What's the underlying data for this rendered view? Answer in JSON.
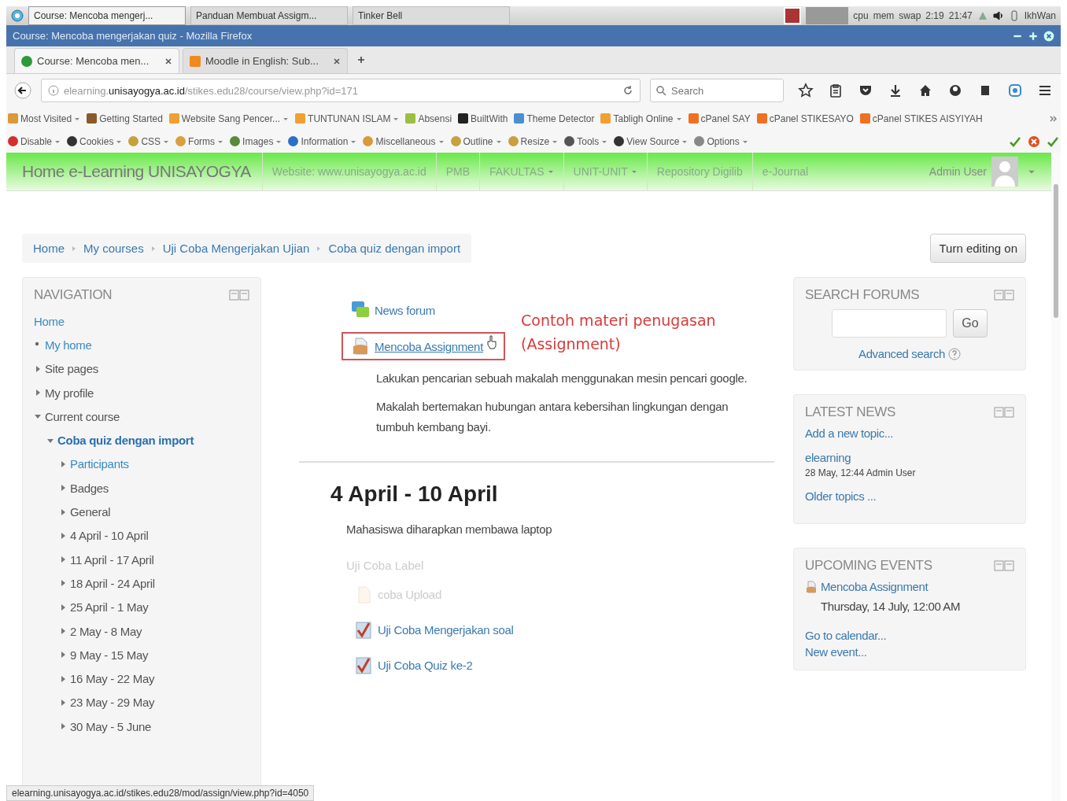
{
  "taskbar": {
    "tasks": [
      {
        "label": "Course: Mencoba mengerj...",
        "selected": true
      },
      {
        "label": "Panduan Membuat Assigm...",
        "selected": false
      },
      {
        "label": "Tinker Bell",
        "selected": false
      }
    ],
    "tray": {
      "cpu": "cpu",
      "mem": "mem",
      "swap": "swap",
      "date": "2:19",
      "time": "21:47",
      "user": "IkhWan"
    }
  },
  "window": {
    "title": "Course: Mencoba mengerjakan quiz - Mozilla Firefox"
  },
  "browser_tabs": [
    {
      "label": "Course: Mencoba men...",
      "kind": "moodle",
      "selected": true
    },
    {
      "label": "Moodle in English: Sub...",
      "kind": "moodle-en",
      "selected": false
    }
  ],
  "url_bar": {
    "url": "elearning.**unisayogya.ac.id**/stikes.edu28/course/view.php?id=171"
  },
  "search": {
    "placeholder": "Search"
  },
  "bookmarks": [
    {
      "label": "Most Visited",
      "kind": "folder",
      "dropdown": true
    },
    {
      "label": "Getting Started",
      "kind": "firefox",
      "dropdown": false
    },
    {
      "label": "Website Sang Pencer...",
      "kind": "feed",
      "dropdown": true
    },
    {
      "label": "TUNTUNAN ISLAM",
      "kind": "feed",
      "dropdown": true
    },
    {
      "label": "Absensi",
      "kind": "star",
      "dropdown": false
    },
    {
      "label": "BuiltWith",
      "kind": "bw",
      "dropdown": false
    },
    {
      "label": "Theme Detector",
      "kind": "page",
      "dropdown": false
    },
    {
      "label": "Tabligh Online",
      "kind": "feed",
      "dropdown": true
    },
    {
      "label": "cPanel SAY",
      "kind": "cpanel",
      "dropdown": false
    },
    {
      "label": "cPanel STIKESAYO",
      "kind": "cpanel",
      "dropdown": false
    },
    {
      "label": "cPanel STIKES AISYIYAH",
      "kind": "cpanel",
      "dropdown": false
    }
  ],
  "dev_toolbar": [
    {
      "label": "Disable",
      "kind": "disable"
    },
    {
      "label": "Cookies",
      "kind": "cookie"
    },
    {
      "label": "CSS",
      "kind": "pen"
    },
    {
      "label": "Forms",
      "kind": "form"
    },
    {
      "label": "Images",
      "kind": "image"
    },
    {
      "label": "Information",
      "kind": "info"
    },
    {
      "label": "Miscellaneous",
      "kind": "misc"
    },
    {
      "label": "Outline",
      "kind": "pen"
    },
    {
      "label": "Resize",
      "kind": "pen"
    },
    {
      "label": "Tools",
      "kind": "tools"
    },
    {
      "label": "View Source",
      "kind": "source"
    },
    {
      "label": "Options",
      "kind": "options"
    }
  ],
  "site_nav": {
    "brand": "Home e-Learning UNISAYOGYA",
    "items": [
      {
        "label": "Website: www.unisayogya.ac.id",
        "dropdown": false
      },
      {
        "label": "PMB",
        "dropdown": false
      },
      {
        "label": "FAKULTAS",
        "dropdown": true
      },
      {
        "label": "UNIT-UNIT",
        "dropdown": true
      },
      {
        "label": "Repository Digilib",
        "dropdown": false
      },
      {
        "label": "e-Journal",
        "dropdown": false
      }
    ],
    "user": "Admin User"
  },
  "breadcrumb": [
    "Home",
    "My courses",
    "Uji Coba Mengerjakan Ujian",
    "Coba quiz dengan import"
  ],
  "edit_button": "Turn editing on",
  "navigation": {
    "title": "NAVIGATION",
    "items": [
      {
        "label": "Home",
        "kind": "heading",
        "link": true,
        "children": [
          {
            "label": "My home",
            "kind": "leaf",
            "link": true
          },
          {
            "label": "Site pages",
            "kind": "branch",
            "expanded": false,
            "link": false
          },
          {
            "label": "My profile",
            "kind": "branch",
            "expanded": false,
            "link": false
          },
          {
            "label": "Current course",
            "kind": "branch",
            "expanded": true,
            "link": false,
            "children": [
              {
                "label": "Coba quiz dengan import",
                "kind": "branch",
                "expanded": true,
                "link": true,
                "current": true,
                "children": [
                  {
                    "label": "Participants",
                    "kind": "branch",
                    "expanded": false,
                    "link": true
                  },
                  {
                    "label": "Badges",
                    "kind": "branch",
                    "expanded": false,
                    "link": false
                  },
                  {
                    "label": "General",
                    "kind": "branch",
                    "expanded": false,
                    "link": false
                  },
                  {
                    "label": "4 April - 10 April",
                    "kind": "branch",
                    "expanded": false,
                    "link": false
                  },
                  {
                    "label": "11 April - 17 April",
                    "kind": "branch",
                    "expanded": false,
                    "link": false
                  },
                  {
                    "label": "18 April - 24 April",
                    "kind": "branch",
                    "expanded": false,
                    "link": false
                  },
                  {
                    "label": "25 April - 1 May",
                    "kind": "branch",
                    "expanded": false,
                    "link": false
                  },
                  {
                    "label": "2 May - 8 May",
                    "kind": "branch",
                    "expanded": false,
                    "link": false
                  },
                  {
                    "label": "9 May - 15 May",
                    "kind": "branch",
                    "expanded": false,
                    "link": false
                  },
                  {
                    "label": "16 May - 22 May",
                    "kind": "branch",
                    "expanded": false,
                    "link": false
                  },
                  {
                    "label": "23 May - 29 May",
                    "kind": "branch",
                    "expanded": false,
                    "link": false
                  },
                  {
                    "label": "30 May - 5 June",
                    "kind": "branch",
                    "expanded": false,
                    "link": false
                  }
                ]
              }
            ]
          }
        ]
      }
    ]
  },
  "topic_0": {
    "activities": [
      {
        "kind": "forum",
        "label": "News forum",
        "highlighted": false
      },
      {
        "kind": "assignment",
        "label": "Mencoba Assignment",
        "highlighted": true
      }
    ],
    "annotation": [
      "Contoh materi penugasan",
      "(Assignment)"
    ],
    "description": [
      "Lakukan pencarian sebuah makalah menggunakan mesin pencari google.",
      "Makalah bertemakan hubungan antara kebersihan lingkungan dengan tumbuh kembang bayi."
    ]
  },
  "section": {
    "title": "4 April - 10 April",
    "summary": "Mahasiswa diharapkan membawa laptop",
    "items": [
      {
        "kind": "label",
        "label": "Uji Coba Label",
        "dimmed": true
      },
      {
        "kind": "file",
        "label": "coba Upload",
        "dimmed": true
      },
      {
        "kind": "quiz",
        "label": "Uji Coba Mengerjakan soal",
        "dimmed": false
      },
      {
        "kind": "quiz",
        "label": "Uji Coba Quiz ke-2",
        "dimmed": false
      }
    ]
  },
  "search_forums": {
    "title": "SEARCH FORUMS",
    "button": "Go",
    "link": "Advanced search"
  },
  "latest_news": {
    "title": "LATEST NEWS",
    "add": "Add a new topic...",
    "posts": [
      {
        "subject": "elearning",
        "meta": "28 May, 12:44  Admin User"
      }
    ],
    "older": "Older topics ..."
  },
  "upcoming_events": {
    "title": "UPCOMING EVENTS",
    "events": [
      {
        "name": "Mencoba Assignment",
        "date": "Thursday, 14 July, 12:00 AM"
      }
    ],
    "links": [
      "Go to calendar...",
      "New event..."
    ]
  },
  "status_bar": {
    "url": "elearning.unisayogya.ac.id/stikes.edu28/mod/assign/view.php?id=4050"
  }
}
